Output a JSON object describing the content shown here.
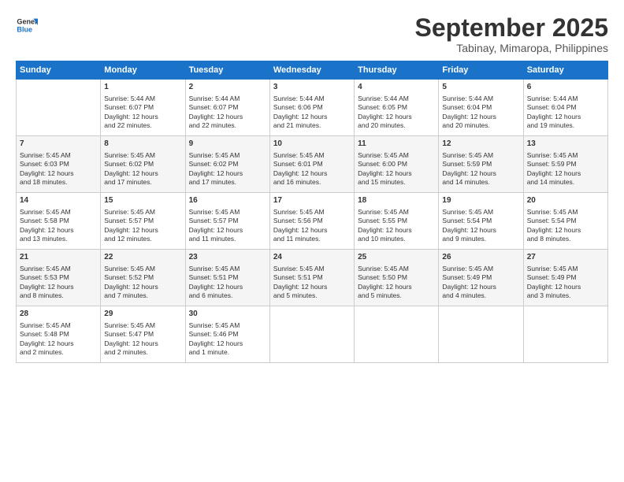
{
  "logo": {
    "line1": "General",
    "line2": "Blue"
  },
  "title": "September 2025",
  "subtitle": "Tabinay, Mimaropa, Philippines",
  "days": [
    "Sunday",
    "Monday",
    "Tuesday",
    "Wednesday",
    "Thursday",
    "Friday",
    "Saturday"
  ],
  "cells": [
    {
      "date": "",
      "content": ""
    },
    {
      "date": "1",
      "content": "Sunrise: 5:44 AM\nSunset: 6:07 PM\nDaylight: 12 hours\nand 22 minutes."
    },
    {
      "date": "2",
      "content": "Sunrise: 5:44 AM\nSunset: 6:07 PM\nDaylight: 12 hours\nand 22 minutes."
    },
    {
      "date": "3",
      "content": "Sunrise: 5:44 AM\nSunset: 6:06 PM\nDaylight: 12 hours\nand 21 minutes."
    },
    {
      "date": "4",
      "content": "Sunrise: 5:44 AM\nSunset: 6:05 PM\nDaylight: 12 hours\nand 20 minutes."
    },
    {
      "date": "5",
      "content": "Sunrise: 5:44 AM\nSunset: 6:04 PM\nDaylight: 12 hours\nand 20 minutes."
    },
    {
      "date": "6",
      "content": "Sunrise: 5:44 AM\nSunset: 6:04 PM\nDaylight: 12 hours\nand 19 minutes."
    },
    {
      "date": "7",
      "content": "Sunrise: 5:45 AM\nSunset: 6:03 PM\nDaylight: 12 hours\nand 18 minutes."
    },
    {
      "date": "8",
      "content": "Sunrise: 5:45 AM\nSunset: 6:02 PM\nDaylight: 12 hours\nand 17 minutes."
    },
    {
      "date": "9",
      "content": "Sunrise: 5:45 AM\nSunset: 6:02 PM\nDaylight: 12 hours\nand 17 minutes."
    },
    {
      "date": "10",
      "content": "Sunrise: 5:45 AM\nSunset: 6:01 PM\nDaylight: 12 hours\nand 16 minutes."
    },
    {
      "date": "11",
      "content": "Sunrise: 5:45 AM\nSunset: 6:00 PM\nDaylight: 12 hours\nand 15 minutes."
    },
    {
      "date": "12",
      "content": "Sunrise: 5:45 AM\nSunset: 5:59 PM\nDaylight: 12 hours\nand 14 minutes."
    },
    {
      "date": "13",
      "content": "Sunrise: 5:45 AM\nSunset: 5:59 PM\nDaylight: 12 hours\nand 14 minutes."
    },
    {
      "date": "14",
      "content": "Sunrise: 5:45 AM\nSunset: 5:58 PM\nDaylight: 12 hours\nand 13 minutes."
    },
    {
      "date": "15",
      "content": "Sunrise: 5:45 AM\nSunset: 5:57 PM\nDaylight: 12 hours\nand 12 minutes."
    },
    {
      "date": "16",
      "content": "Sunrise: 5:45 AM\nSunset: 5:57 PM\nDaylight: 12 hours\nand 11 minutes."
    },
    {
      "date": "17",
      "content": "Sunrise: 5:45 AM\nSunset: 5:56 PM\nDaylight: 12 hours\nand 11 minutes."
    },
    {
      "date": "18",
      "content": "Sunrise: 5:45 AM\nSunset: 5:55 PM\nDaylight: 12 hours\nand 10 minutes."
    },
    {
      "date": "19",
      "content": "Sunrise: 5:45 AM\nSunset: 5:54 PM\nDaylight: 12 hours\nand 9 minutes."
    },
    {
      "date": "20",
      "content": "Sunrise: 5:45 AM\nSunset: 5:54 PM\nDaylight: 12 hours\nand 8 minutes."
    },
    {
      "date": "21",
      "content": "Sunrise: 5:45 AM\nSunset: 5:53 PM\nDaylight: 12 hours\nand 8 minutes."
    },
    {
      "date": "22",
      "content": "Sunrise: 5:45 AM\nSunset: 5:52 PM\nDaylight: 12 hours\nand 7 minutes."
    },
    {
      "date": "23",
      "content": "Sunrise: 5:45 AM\nSunset: 5:51 PM\nDaylight: 12 hours\nand 6 minutes."
    },
    {
      "date": "24",
      "content": "Sunrise: 5:45 AM\nSunset: 5:51 PM\nDaylight: 12 hours\nand 5 minutes."
    },
    {
      "date": "25",
      "content": "Sunrise: 5:45 AM\nSunset: 5:50 PM\nDaylight: 12 hours\nand 5 minutes."
    },
    {
      "date": "26",
      "content": "Sunrise: 5:45 AM\nSunset: 5:49 PM\nDaylight: 12 hours\nand 4 minutes."
    },
    {
      "date": "27",
      "content": "Sunrise: 5:45 AM\nSunset: 5:49 PM\nDaylight: 12 hours\nand 3 minutes."
    },
    {
      "date": "28",
      "content": "Sunrise: 5:45 AM\nSunset: 5:48 PM\nDaylight: 12 hours\nand 2 minutes."
    },
    {
      "date": "29",
      "content": "Sunrise: 5:45 AM\nSunset: 5:47 PM\nDaylight: 12 hours\nand 2 minutes."
    },
    {
      "date": "30",
      "content": "Sunrise: 5:45 AM\nSunset: 5:46 PM\nDaylight: 12 hours\nand 1 minute."
    },
    {
      "date": "",
      "content": ""
    },
    {
      "date": "",
      "content": ""
    },
    {
      "date": "",
      "content": ""
    },
    {
      "date": "",
      "content": ""
    }
  ]
}
